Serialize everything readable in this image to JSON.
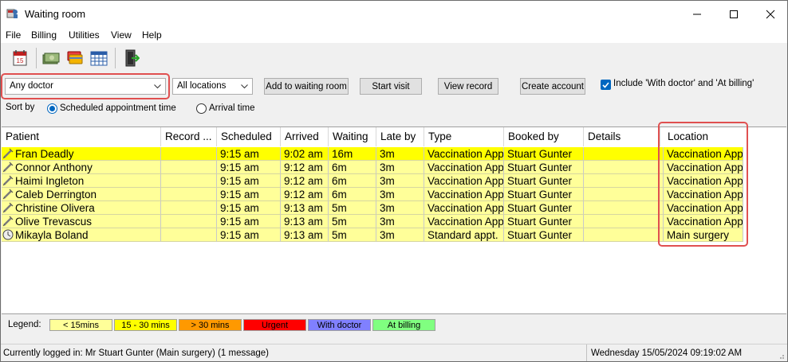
{
  "window": {
    "title": "Waiting room"
  },
  "menu": [
    "File",
    "Billing",
    "Utilities",
    "View",
    "Help"
  ],
  "toolbar": {
    "icons": [
      "calendar-icon",
      "money-icon",
      "cards-icon",
      "grid-calendar-icon",
      "exit-door-icon"
    ]
  },
  "filters": {
    "doctor": "Any doctor",
    "location": "All locations",
    "add_button": "Add to waiting room",
    "start_button": "Start visit",
    "view_button": "View record",
    "create_button": "Create account",
    "include_checkbox": "Include 'With doctor' and 'At billing'",
    "include_checked": true,
    "sort_label": "Sort by",
    "sort_scheduled": "Scheduled appointment time",
    "sort_arrival": "Arrival time",
    "sort_selected": "scheduled"
  },
  "table": {
    "columns": [
      "Patient",
      "Record ...",
      "Scheduled",
      "Arrived",
      "Waiting",
      "Late by",
      "Type",
      "Booked by",
      "Details",
      "Location"
    ],
    "rows": [
      {
        "icon": "syringe-icon",
        "patient": "Fran Deadly",
        "record": "",
        "scheduled": "9:15 am",
        "arrived": "9:02 am",
        "waiting": "16m",
        "late": "3m",
        "type": "Vaccination Appo",
        "booked": "Stuart Gunter",
        "details": "",
        "location": "Vaccination Appo",
        "color": "#ffff00"
      },
      {
        "icon": "syringe-icon",
        "patient": "Connor Anthony",
        "record": "",
        "scheduled": "9:15 am",
        "arrived": "9:12 am",
        "waiting": "6m",
        "late": "3m",
        "type": "Vaccination Appo",
        "booked": "Stuart Gunter",
        "details": "",
        "location": "Vaccination Appo",
        "color": "#ffff99"
      },
      {
        "icon": "syringe-icon",
        "patient": "Haimi Ingleton",
        "record": "",
        "scheduled": "9:15 am",
        "arrived": "9:12 am",
        "waiting": "6m",
        "late": "3m",
        "type": "Vaccination Appo",
        "booked": "Stuart Gunter",
        "details": "",
        "location": "Vaccination Appo",
        "color": "#ffff99"
      },
      {
        "icon": "syringe-icon",
        "patient": "Caleb Derrington",
        "record": "",
        "scheduled": "9:15 am",
        "arrived": "9:12 am",
        "waiting": "6m",
        "late": "3m",
        "type": "Vaccination Appo",
        "booked": "Stuart Gunter",
        "details": "",
        "location": "Vaccination Appo",
        "color": "#ffff99"
      },
      {
        "icon": "syringe-icon",
        "patient": "Christine Olivera",
        "record": "",
        "scheduled": "9:15 am",
        "arrived": "9:13 am",
        "waiting": "5m",
        "late": "3m",
        "type": "Vaccination Appo",
        "booked": "Stuart Gunter",
        "details": "",
        "location": "Vaccination Appo",
        "color": "#ffff99"
      },
      {
        "icon": "syringe-icon",
        "patient": "Olive Trevascus",
        "record": "",
        "scheduled": "9:15 am",
        "arrived": "9:13 am",
        "waiting": "5m",
        "late": "3m",
        "type": "Vaccination Appo",
        "booked": "Stuart Gunter",
        "details": "",
        "location": "Vaccination Appo",
        "color": "#ffff99"
      },
      {
        "icon": "clock-icon",
        "patient": "Mikayla Boland",
        "record": "",
        "scheduled": "9:15 am",
        "arrived": "9:13 am",
        "waiting": "5m",
        "late": "3m",
        "type": "Standard appt.",
        "booked": "Stuart Gunter",
        "details": "",
        "location": "Main surgery",
        "color": "#ffff99"
      }
    ]
  },
  "legend": {
    "label": "Legend:",
    "items": [
      {
        "text": "< 15mins",
        "color": "#ffff99"
      },
      {
        "text": "15 - 30 mins",
        "color": "#ffff00"
      },
      {
        "text": "> 30 mins",
        "color": "#ff9900"
      },
      {
        "text": "Urgent",
        "color": "#ff0000"
      },
      {
        "text": "With doctor",
        "color": "#8080ff"
      },
      {
        "text": "At billing",
        "color": "#80ff80"
      }
    ]
  },
  "status": {
    "left": "Currently logged in:  Mr Stuart Gunter (Main surgery) (1 message)",
    "right": "Wednesday 15/05/2024 09:19:02 AM"
  },
  "colors": {
    "highlight": "#e05050",
    "accent": "#0067c0"
  }
}
